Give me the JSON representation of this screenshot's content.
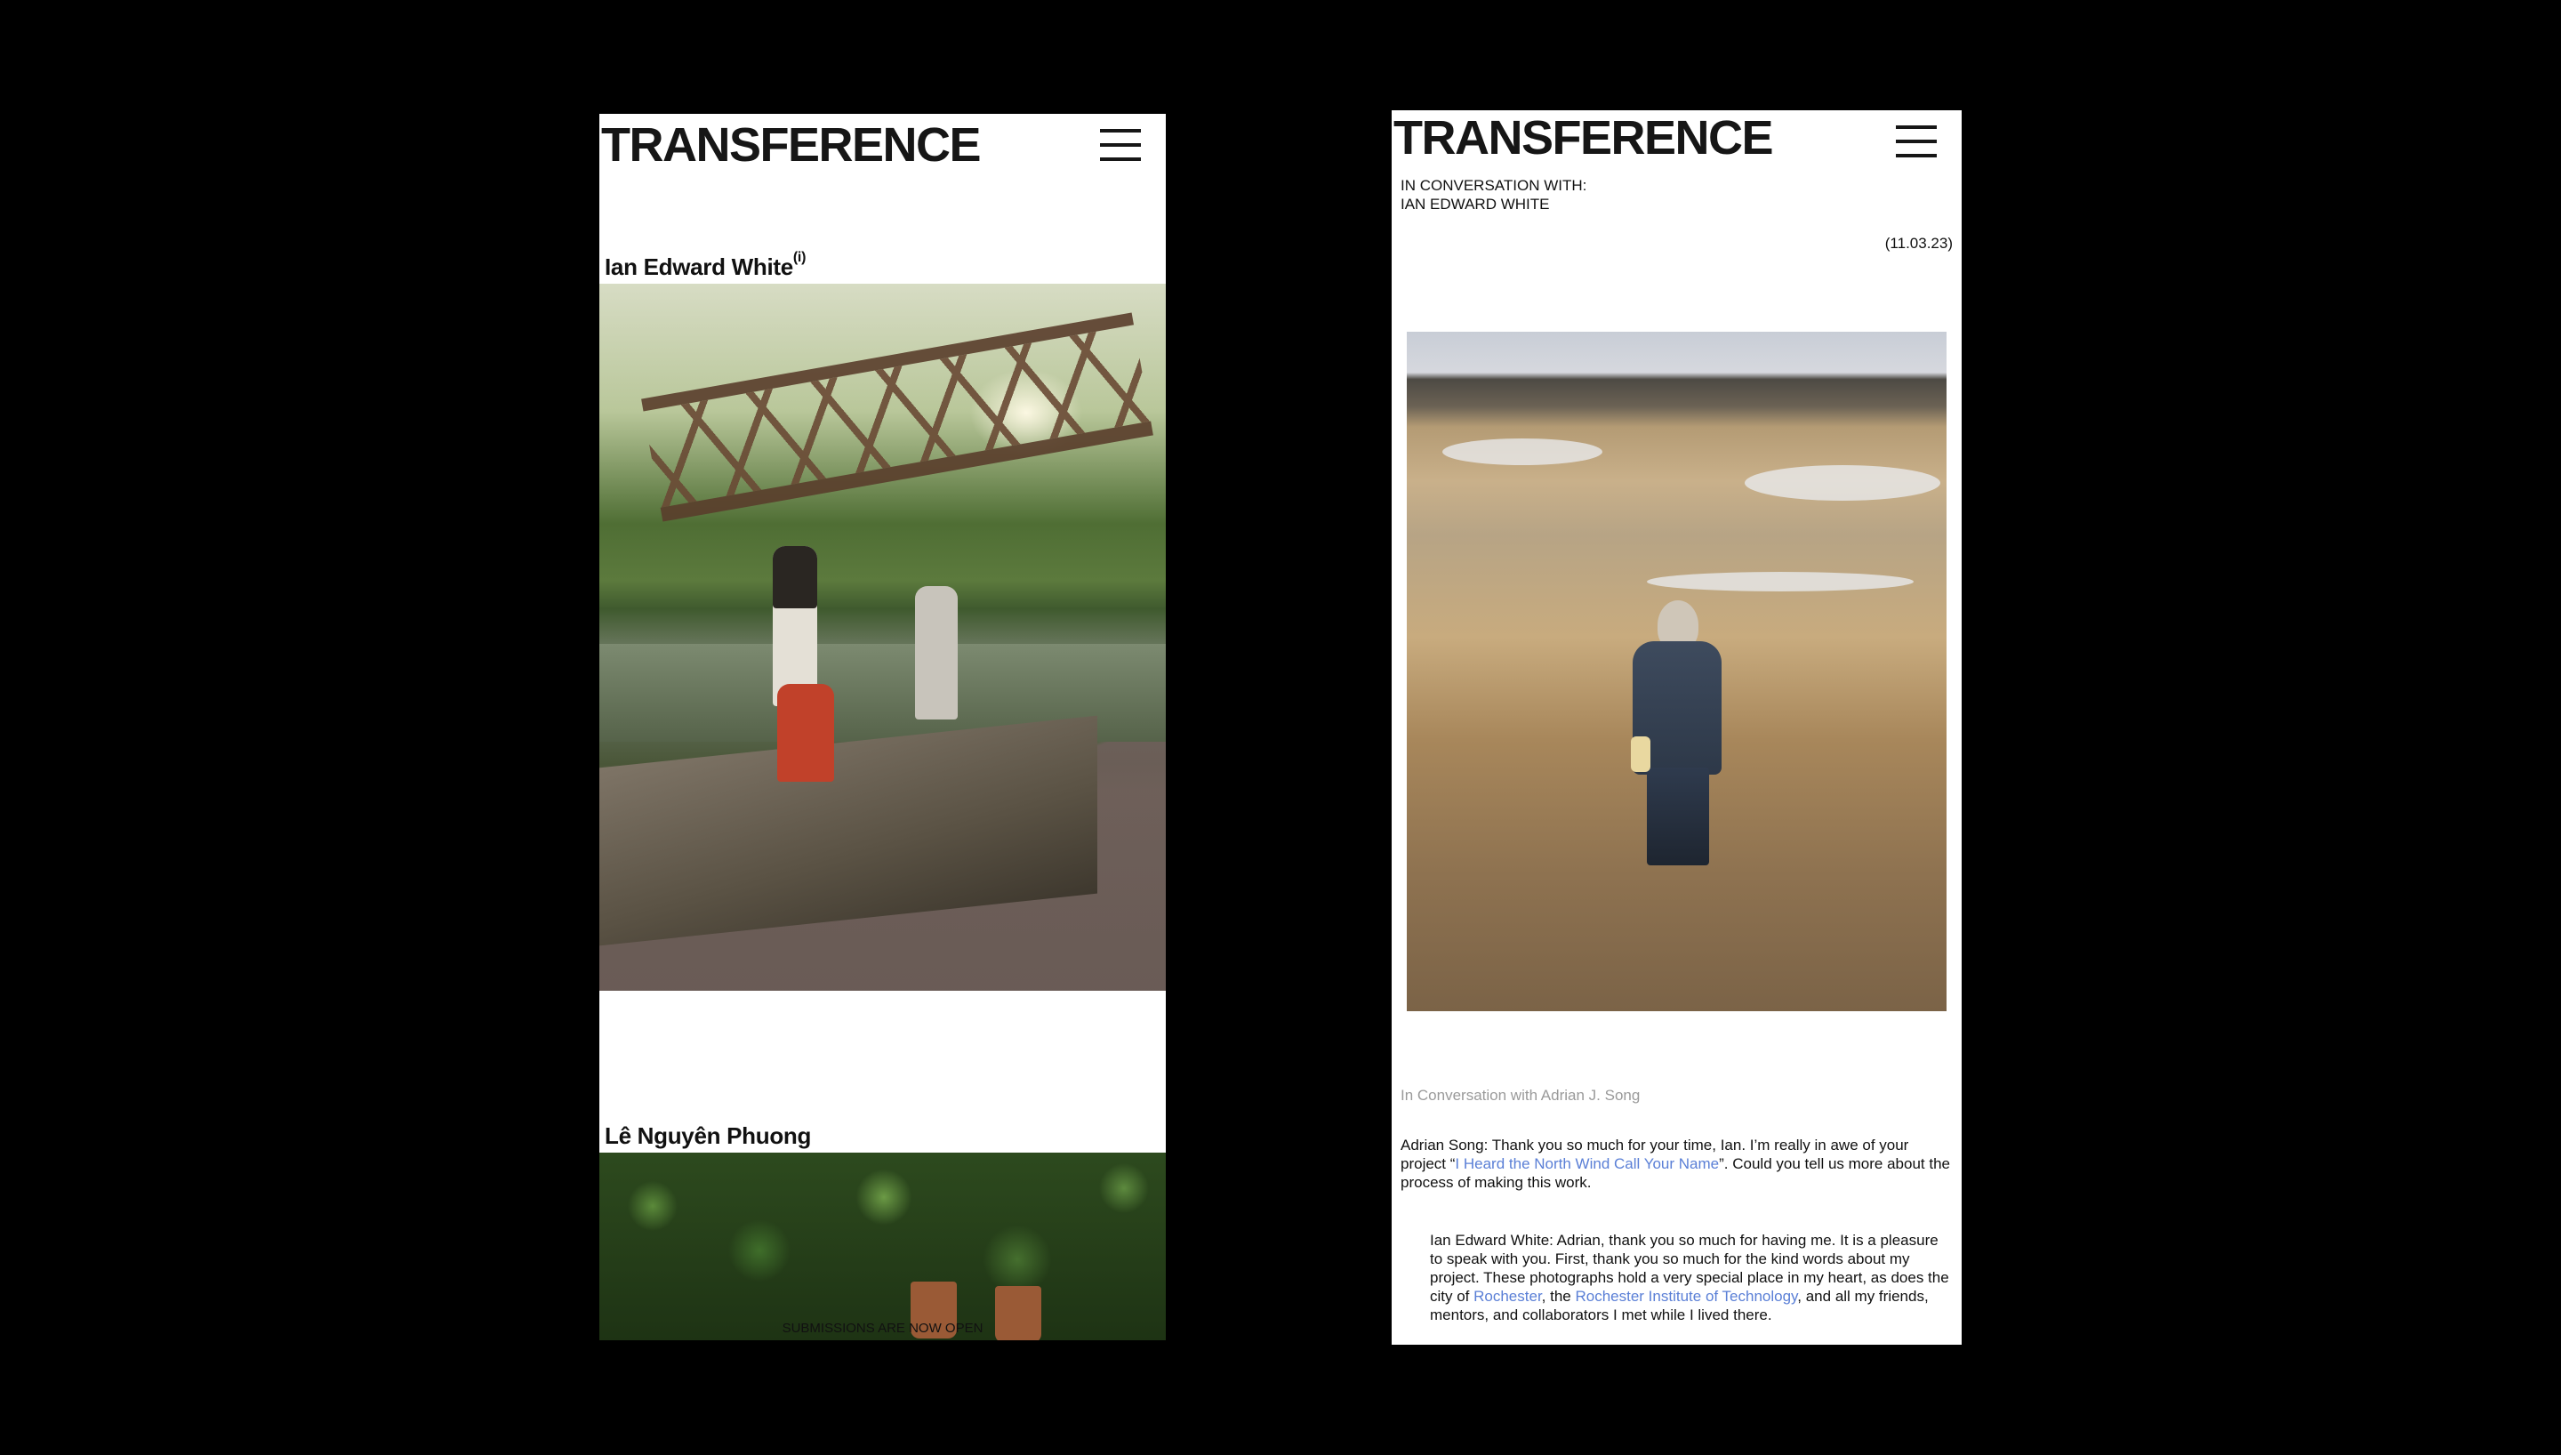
{
  "left": {
    "logo": "TRANSFERENCE",
    "artist1": {
      "name": "Ian Edward White",
      "sup": "(i)"
    },
    "artist2": {
      "name": "Lê Nguyên Phuong"
    },
    "marquee": "SUBMISSIONS ARE NOW OPEN"
  },
  "right": {
    "logo": "TRANSFERENCE",
    "conversation_label": "IN CONVERSATION WITH:",
    "conversation_name": "IAN EDWARD WHITE",
    "date": "(11.03.23)",
    "byline": "In Conversation with Adrian J. Song",
    "q1": {
      "part1": "Adrian Song: Thank you so much for your time, Ian. I’m really in awe of your project “",
      "link": "I Heard the North Wind Call Your Name",
      "part2": "”. Could you tell us more about the process of making this work."
    },
    "a1": {
      "part1": "Ian Edward White: Adrian, thank you so much for having me. It is a pleasure to speak with you. First, thank you so much for the kind words about my project. These photographs hold a very special place in my heart, as does the city of ",
      "link1": "Rochester",
      "part2": ", the ",
      "link2": "Rochester Institute of Technology",
      "part3": ", and all my friends, mentors, and collaborators I met while I lived there."
    }
  },
  "colors": {
    "background": "#000000",
    "page": "#ffffff",
    "link": "#5a7fd6",
    "muted": "#9a9a9a"
  },
  "icons": {
    "menu": "hamburger-icon"
  }
}
